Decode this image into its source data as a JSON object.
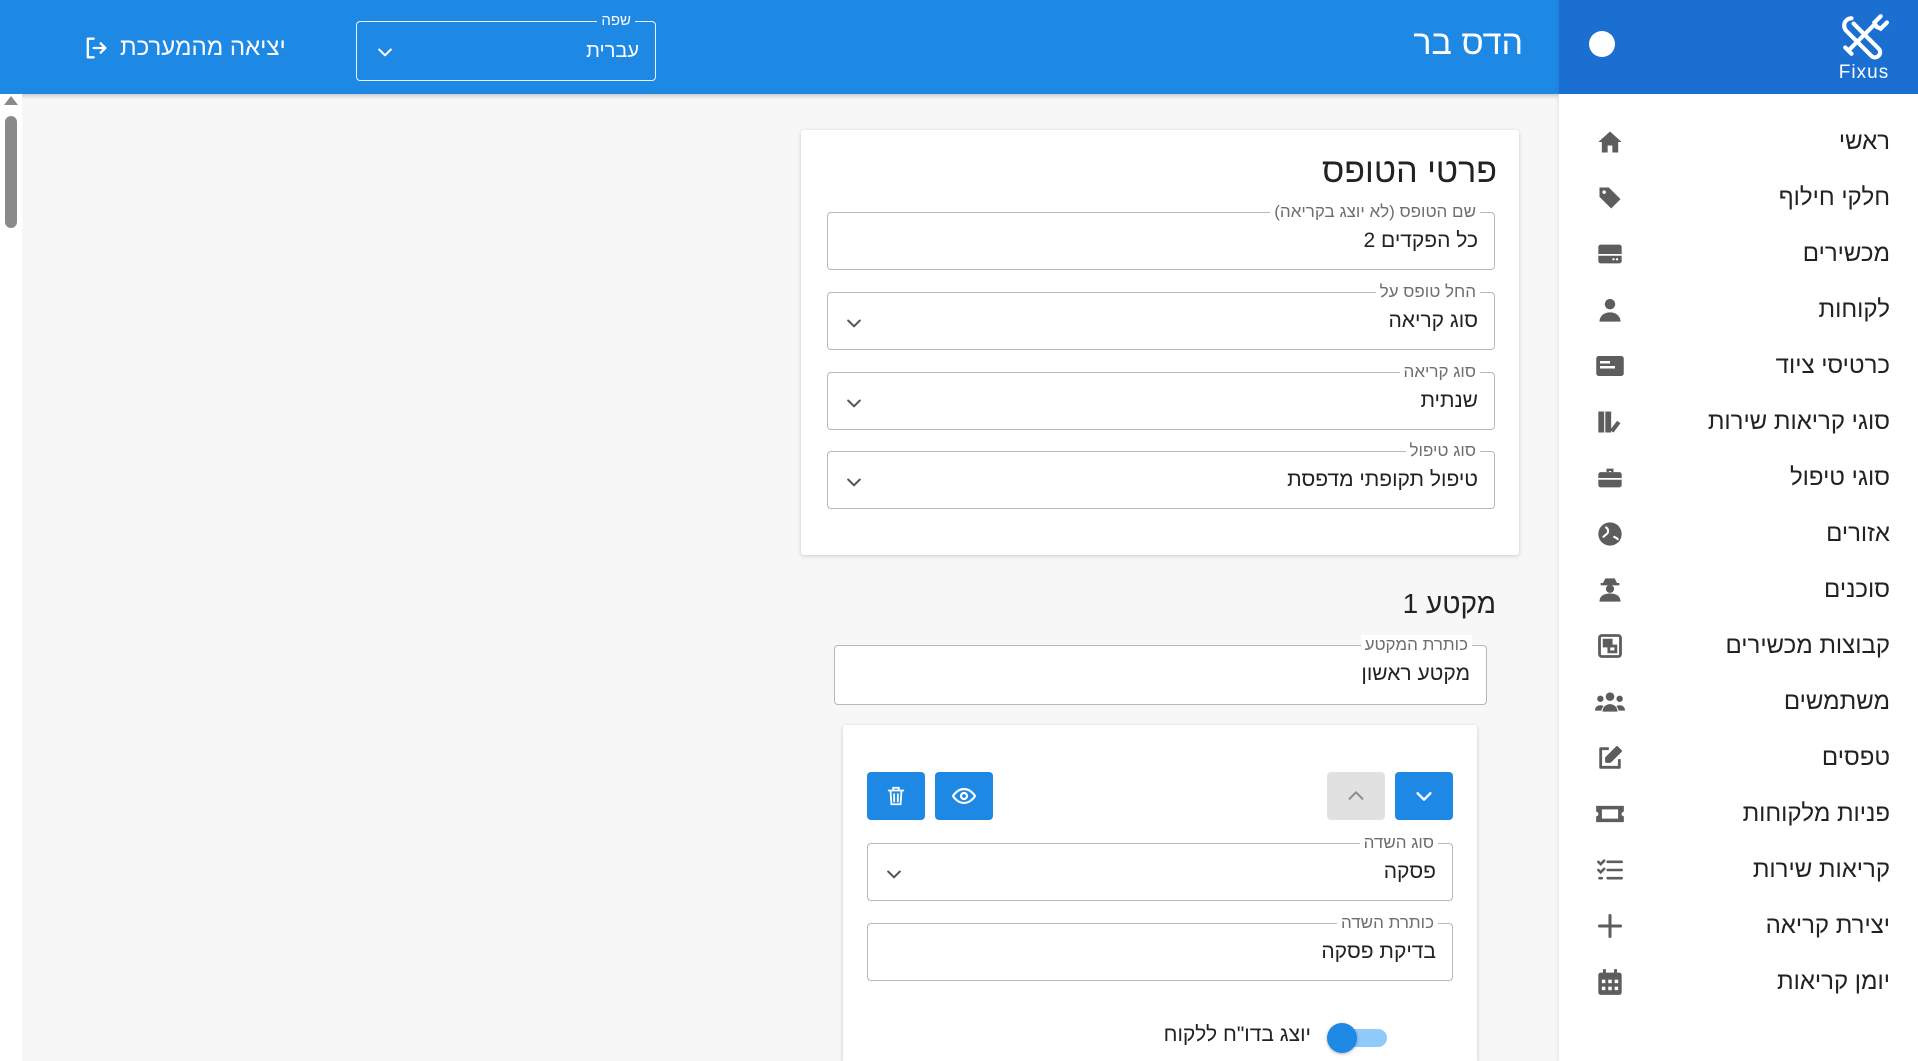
{
  "sidebar": {
    "logo_text": "Fixus",
    "items": [
      {
        "label": "ראשי",
        "icon": "home-icon"
      },
      {
        "label": "חלקי חילוף",
        "icon": "tags-icon"
      },
      {
        "label": "מכשירים",
        "icon": "device-icon"
      },
      {
        "label": "לקוחות",
        "icon": "customer-icon"
      },
      {
        "label": "כרטיסי ציוד",
        "icon": "equipment-card-icon"
      },
      {
        "label": "סוגי קריאות שירות",
        "icon": "call-types-icon"
      },
      {
        "label": "סוגי טיפול",
        "icon": "toolbox-icon"
      },
      {
        "label": "אזורים",
        "icon": "globe-icon"
      },
      {
        "label": "סוכנים",
        "icon": "agent-icon"
      },
      {
        "label": "קבוצות מכשירים",
        "icon": "device-groups-icon"
      },
      {
        "label": "משתמשים",
        "icon": "users-icon"
      },
      {
        "label": "טפסים",
        "icon": "edit-form-icon"
      },
      {
        "label": "פניות מלקוחות",
        "icon": "ticket-icon"
      },
      {
        "label": "קריאות שירות",
        "icon": "checklist-icon"
      },
      {
        "label": "יצירת קריאה",
        "icon": "plus-icon"
      },
      {
        "label": "יומן קריאות",
        "icon": "calendar-icon"
      }
    ]
  },
  "header": {
    "title": "הדס בר",
    "language": {
      "label": "שפה",
      "value": "עברית"
    },
    "logout_label": "יציאה מהמערכת"
  },
  "form": {
    "title": "פרטי הטופס",
    "fields": [
      {
        "label": "שם הטופס (לא יוצג בקריאה)",
        "value": "כל הפקדים 2",
        "type": "text"
      },
      {
        "label": "החל טופס על",
        "value": "סוג קריאה",
        "type": "select"
      },
      {
        "label": "סוג קריאה",
        "value": "שנתית",
        "type": "select"
      },
      {
        "label": "סוג טיפול",
        "value": "טיפול תקופתי מדפסת",
        "type": "select"
      }
    ]
  },
  "section": {
    "title": "מקטע 1",
    "title_field": {
      "label": "כותרת המקטע",
      "value": "מקטע ראשון"
    }
  },
  "field_editor": {
    "field_type": {
      "label": "סוג השדה",
      "value": "פסקה"
    },
    "field_title": {
      "label": "כותרת השדה",
      "value": "בדיקת פסקה"
    },
    "toggle_label": "יוצג בדו\"ח ללקוח",
    "toggle_on": true
  },
  "colors": {
    "primary": "#1e88e5",
    "sidebar_header": "#1b6fd0",
    "toggle_track": "#90caf9"
  }
}
